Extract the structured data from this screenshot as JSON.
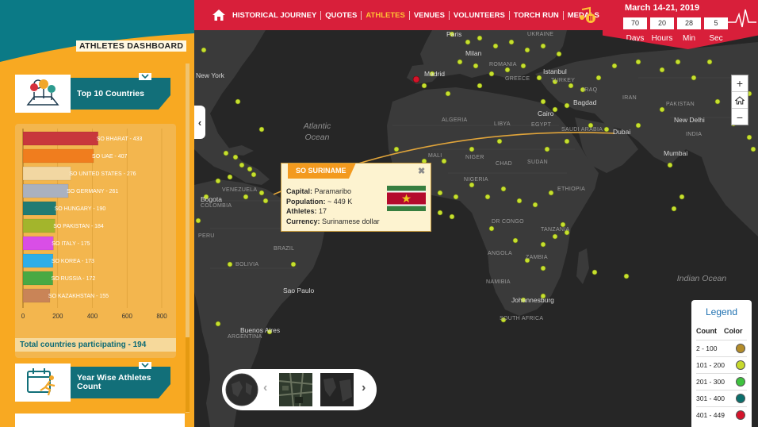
{
  "header": {
    "nav": [
      {
        "label": "HISTORICAL JOURNEY",
        "active": false
      },
      {
        "label": "QUOTES",
        "active": false
      },
      {
        "label": "ATHLETES",
        "active": true
      },
      {
        "label": "VENUES",
        "active": false
      },
      {
        "label": "VOLUNTEERS",
        "active": false
      },
      {
        "label": "TORCH RUN",
        "active": false
      },
      {
        "label": "MEDALS",
        "active": false
      }
    ],
    "icons": [
      "home-icon",
      "music-pause-icon",
      "pulse-logo-icon"
    ],
    "countdown": {
      "date": "March 14-21, 2019",
      "days": "70",
      "hours": "20",
      "min": "28",
      "sec": "5",
      "days_label": "Days",
      "hours_label": "Hours",
      "min_label": "Min",
      "sec_label": "Sec"
    },
    "colors": {
      "primary": "#d81f3a",
      "teal": "#0b7a86",
      "active": "#ffc234"
    }
  },
  "sidebar": {
    "title": "ATHLETES DASHBOARD",
    "top10": {
      "title": "Top 10 Countries",
      "icon": "map-pins-icon",
      "total_text": "Total countries participating - 194"
    },
    "year_wise": {
      "title": "Year Wise Athletes Count",
      "icon": "calendar-runner-icon"
    },
    "colors": {
      "background": "#f8a922"
    }
  },
  "chart_data": {
    "type": "bar",
    "orientation": "horizontal",
    "categories": [
      "SO BHARAT",
      "SO UAE",
      "SO UNITED STATES",
      "SO GERMANY",
      "SO HUNGARY",
      "SO PAKISTAN",
      "SO ITALY",
      "SO KOREA",
      "SO RUSSIA",
      "SO KAZAKHSTAN"
    ],
    "values": [
      433,
      407,
      276,
      261,
      190,
      184,
      175,
      173,
      172,
      155
    ],
    "labels": [
      "SO BHARAT - 433",
      "SO UAE - 407",
      "SO UNITED STATES - 276",
      "SO GERMANY - 261",
      "SO HUNGARY - 190",
      "SO PAKISTAN - 184",
      "SO ITALY - 175",
      "SO KOREA - 173",
      "SO RUSSIA - 172",
      "SO KAZAKHSTAN - 155"
    ],
    "colors": [
      "#c8373c",
      "#f07d1e",
      "#f2d7a2",
      "#aab1bf",
      "#217b73",
      "#a3b52c",
      "#d94ee6",
      "#2eaee8",
      "#49a943",
      "#c98457"
    ],
    "xticks": [
      "0",
      "200",
      "400",
      "600",
      "800"
    ],
    "xlim": [
      0,
      800
    ],
    "grid": true
  },
  "map": {
    "ocean_labels": [
      "Atlantic Ocean",
      "Indian Ocean"
    ],
    "cities": [
      "New York",
      "Paris",
      "Milan",
      "Madrid",
      "Istanbul",
      "Bagdad",
      "Cairo",
      "Dubai",
      "New Delhi",
      "Mumbai",
      "Bogota",
      "Sao Paulo",
      "Buenos Aires",
      "Johannesburg"
    ],
    "countries": [
      "UKRAINE",
      "ROMANIA",
      "GREECE",
      "TURKEY",
      "IRAQ",
      "ALGERIA",
      "LIBYA",
      "EGYPT",
      "SAUDI ARABIA",
      "MALI",
      "NIGER",
      "CHAD",
      "SUDAN",
      "NIGERIA",
      "ETHIOPIA",
      "DR CONGO",
      "TANZANIA",
      "ANGOLA",
      "ZAMBIA",
      "NAMIBIA",
      "SOUTH AFRICA",
      "VENEZUELA",
      "COLOMBIA",
      "PERU",
      "BOLIVIA",
      "BRAZIL",
      "ARGENTINA",
      "INDIA",
      "PAKISTAN",
      "IRAN"
    ],
    "route_color": "#e0a43a",
    "dot_color": "#c6e02e"
  },
  "popup": {
    "title": "SO SURINAME",
    "capital_label": "Capital:",
    "capital": "Paramaribo",
    "population_label": "Population:",
    "population": "~ 449 K",
    "athletes_label": "Athletes:",
    "athletes": "17",
    "currency_label": "Currency:",
    "currency": "Surinamese dollar",
    "close": "✖"
  },
  "zoom": {
    "in": "+",
    "home": "home-icon",
    "out": "−"
  },
  "legend": {
    "title": "Legend",
    "count_label": "Count",
    "color_label": "Color",
    "rows": [
      {
        "range": "2 - 100",
        "color": "#b48d2a"
      },
      {
        "range": "101 - 200",
        "color": "#c7d92d"
      },
      {
        "range": "201 - 300",
        "color": "#3ec23e"
      },
      {
        "range": "301 - 400",
        "color": "#0b6f6c"
      },
      {
        "range": "401 - 449",
        "color": "#d4142b"
      }
    ]
  },
  "carousel": {
    "prev": "‹",
    "next": "›",
    "layers": [
      "dark-map-thumbnail",
      "satellite-thumbnail",
      "dark-terrain-thumbnail"
    ]
  }
}
